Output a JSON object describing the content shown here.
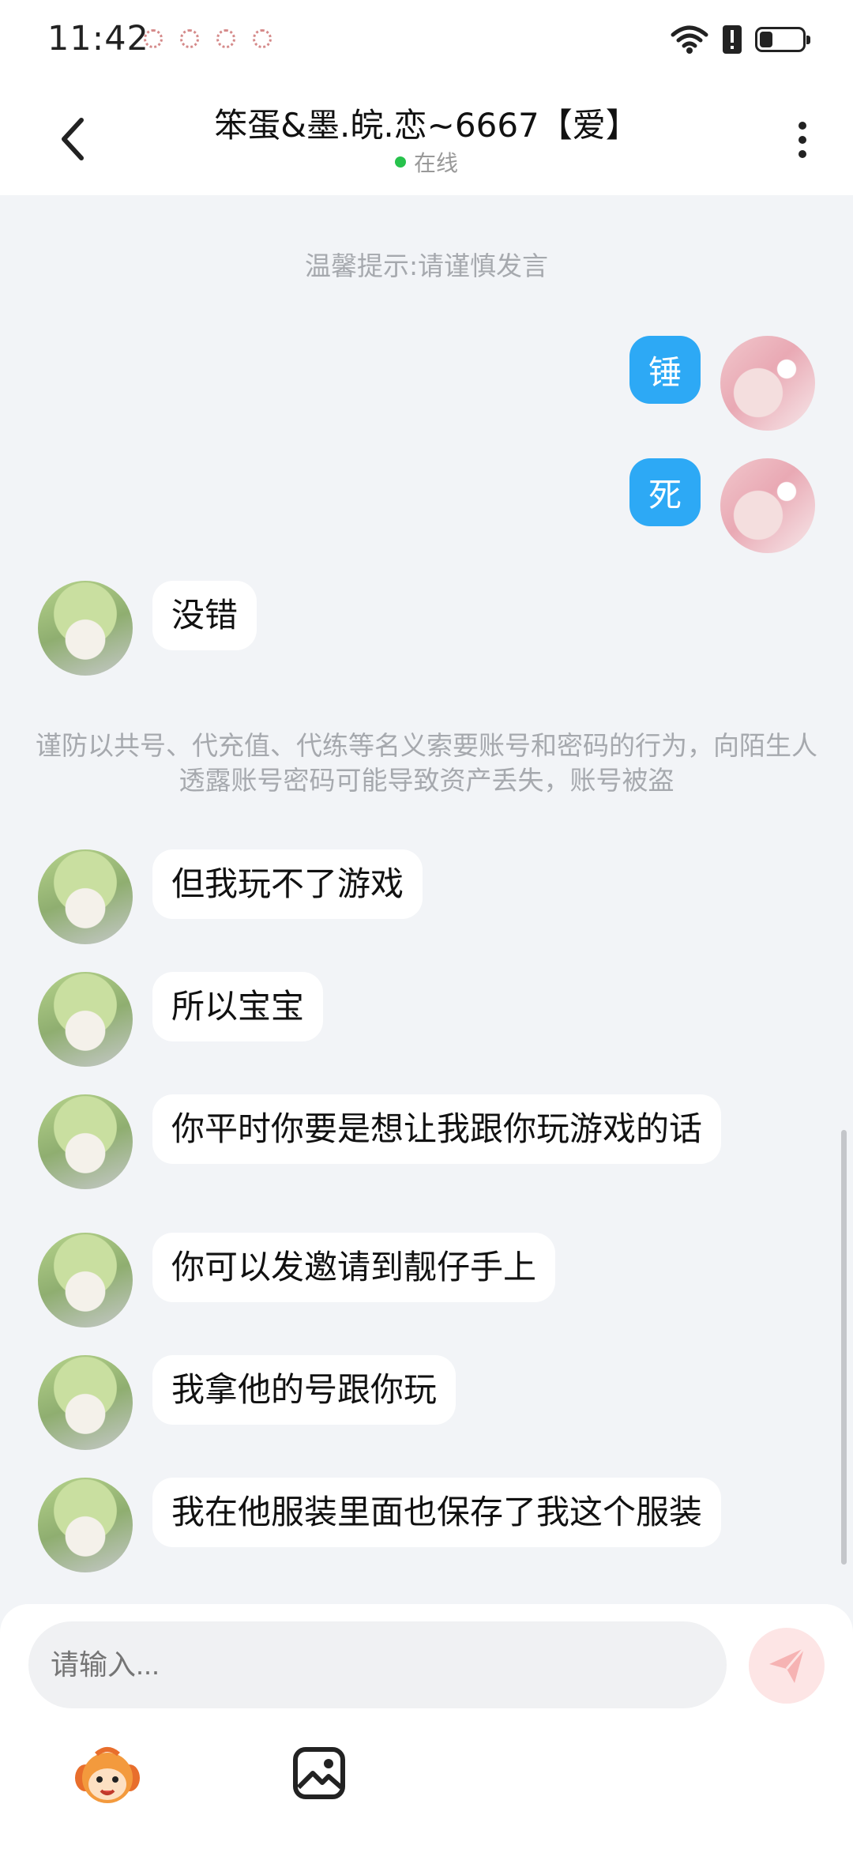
{
  "status_bar": {
    "time": "11:42",
    "icons": [
      "notification-dot-icon",
      "notification-dot-icon",
      "notification-dot-icon",
      "notification-dot-icon",
      "wifi-icon",
      "alert-icon",
      "battery-icon"
    ]
  },
  "header": {
    "title": "笨蛋&墨.皖.恋~6667【爱】",
    "status": "在线",
    "back_icon": "chevron-left-icon",
    "more_icon": "more-vertical-icon"
  },
  "chat": {
    "tip": "温馨提示:请谨慎发言",
    "warning": "谨防以共号、代充值、代练等名义索要账号和密码的行为，向陌生人透露账号密码可能导致资产丢失，账号被盗",
    "messages": [
      {
        "from": "me",
        "text": "锤"
      },
      {
        "from": "me",
        "text": "死"
      },
      {
        "from": "other",
        "text": "没错"
      },
      {
        "from": "other",
        "text": "但我玩不了游戏"
      },
      {
        "from": "other",
        "text": "所以宝宝"
      },
      {
        "from": "other",
        "text": "你平时你要是想让我跟你玩游戏的话"
      },
      {
        "from": "other",
        "text": "你可以发邀请到靓仔手上"
      },
      {
        "from": "other",
        "text": "我拿他的号跟你玩"
      },
      {
        "from": "other",
        "text": "我在他服装里面也保存了我这个服装"
      }
    ]
  },
  "input": {
    "placeholder": "请输入...",
    "send_icon": "send-icon",
    "emoji_icon": "sticker-icon",
    "image_icon": "image-icon"
  },
  "colors": {
    "my_bubble": "#2da9f5",
    "other_bubble": "#ffffff",
    "background": "#f2f4f7",
    "online": "#27c24c"
  }
}
